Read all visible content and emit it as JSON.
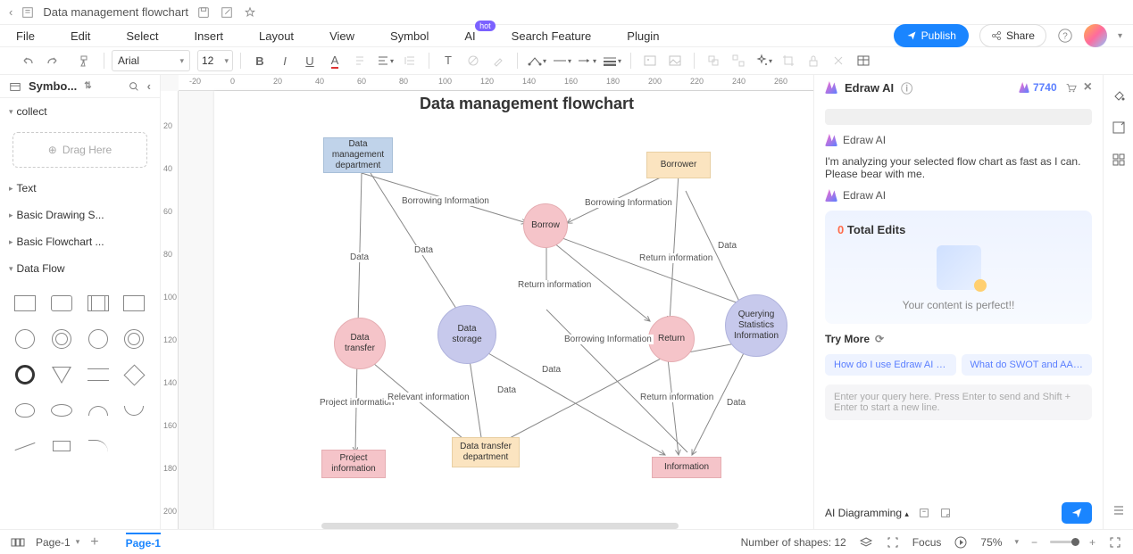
{
  "title": "Data management flowchart",
  "menu": [
    "File",
    "Edit",
    "Select",
    "Insert",
    "Layout",
    "View",
    "Symbol",
    "AI",
    "Search Feature",
    "Plugin"
  ],
  "hot_badge": "hot",
  "publish": "Publish",
  "share": "Share",
  "font": "Arial",
  "font_size": "12",
  "sidebar": {
    "title": "Symbo...",
    "collect": "collect",
    "drag": "Drag Here",
    "cats": [
      "Text",
      "Basic Drawing S...",
      "Basic Flowchart ...",
      "Data Flow"
    ]
  },
  "ruler_h": [
    "-20",
    "0",
    "20",
    "40",
    "60",
    "80",
    "100",
    "120",
    "140",
    "160",
    "180",
    "200",
    "220",
    "240",
    "260"
  ],
  "ruler_v": [
    "20",
    "40",
    "60",
    "80",
    "100",
    "120",
    "140",
    "160",
    "180",
    "200"
  ],
  "canvas_title": "Data management flowchart",
  "nodes": {
    "dept": "Data management department",
    "borrower": "Borrower",
    "borrow": "Borrow",
    "transfer": "Data transfer",
    "storage": "Data storage",
    "return": "Return",
    "query": "Querying Statistics Information",
    "proj": "Project information",
    "xfer_dept": "Data transfer department",
    "info": "Information"
  },
  "edges": {
    "bi1": "Borrowing Information",
    "bi2": "Borrowing Information",
    "bi3": "Borrowing Information",
    "data1": "Data",
    "data2": "Data",
    "data3": "Data",
    "data4": "Data",
    "data5": "Data",
    "data6": "Data",
    "ri1": "Return information",
    "ri2": "Return information",
    "ri3": "Return information",
    "pi": "Project information",
    "rel": "Relevant information"
  },
  "ai": {
    "title": "Edraw AI",
    "credits": "7740",
    "msg1": "I'm analyzing your selected flow chart as fast as I can. Please bear with me.",
    "total_edits_n": "0",
    "total_edits": "Total Edits",
    "perfect": "Your content is perfect!!",
    "try_more": "Try More",
    "sugg1": "How do I use Edraw AI fo...",
    "sugg2": "What do SWOT and AAR...",
    "placeholder": "Enter your query here. Press Enter to send and Shift + Enter to start a new line.",
    "mode": "AI Diagramming"
  },
  "status": {
    "page_dd": "Page-1",
    "tab": "Page-1",
    "shapes": "Number of shapes: 12",
    "focus": "Focus",
    "zoom": "75%"
  }
}
